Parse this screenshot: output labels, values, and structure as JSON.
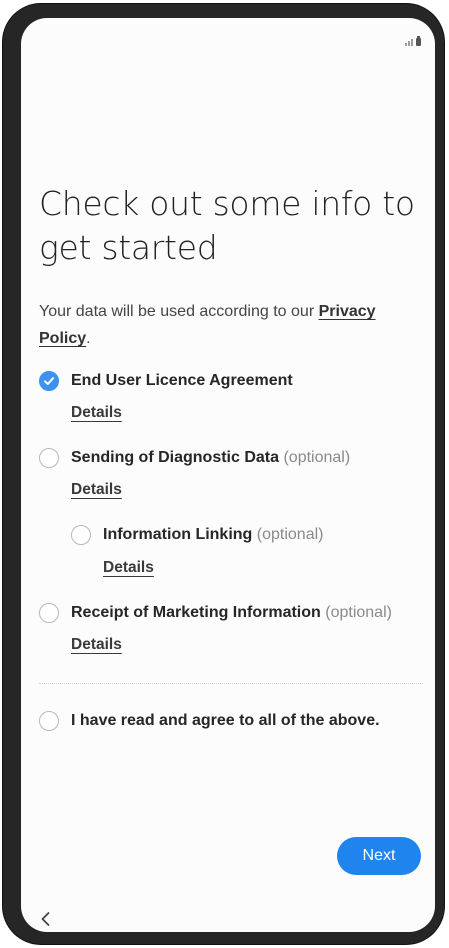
{
  "title": "Check out some info to get started",
  "subtitle": {
    "text": "Your data will be used according to our ",
    "link": "Privacy Policy",
    "suffix": "."
  },
  "items": [
    {
      "label": "End User Licence Agreement",
      "optional": "",
      "checked": true,
      "details": "Details"
    },
    {
      "label": "Sending of Diagnostic Data",
      "optional": "(optional)",
      "checked": false,
      "details": "Details"
    },
    {
      "label": "Information Linking",
      "optional": "(optional)",
      "checked": false,
      "details": "Details"
    },
    {
      "label": "Receipt of Marketing Information",
      "optional": "(optional)",
      "checked": false,
      "details": "Details"
    }
  ],
  "agree_all": {
    "label": "I have read and agree to all of the above.",
    "checked": false
  },
  "next_label": "Next",
  "icons": {
    "check": "checkmark-icon",
    "back": "chevron-left-icon",
    "signal": "signal-icon",
    "battery": "battery-icon"
  },
  "colors": {
    "accent": "#3e91f0",
    "button": "#1f84ee",
    "frame": "#262626"
  }
}
